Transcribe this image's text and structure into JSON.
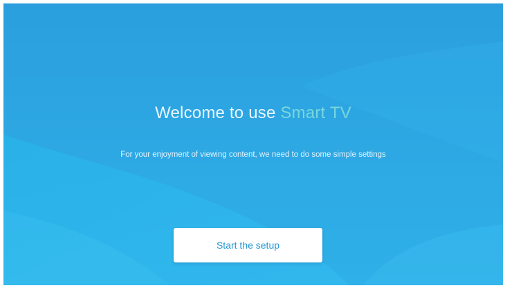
{
  "welcome": {
    "title_prefix": "Welcome to use",
    "title_brand": "Smart TV",
    "subtitle": "For your enjoyment of viewing content, we need to do some simple settings",
    "start_button_label": "Start the setup"
  },
  "colors": {
    "background": "#2ea7e3",
    "brand_accent": "#79d7dd",
    "button_text": "#2398d4",
    "button_background": "#ffffff"
  }
}
